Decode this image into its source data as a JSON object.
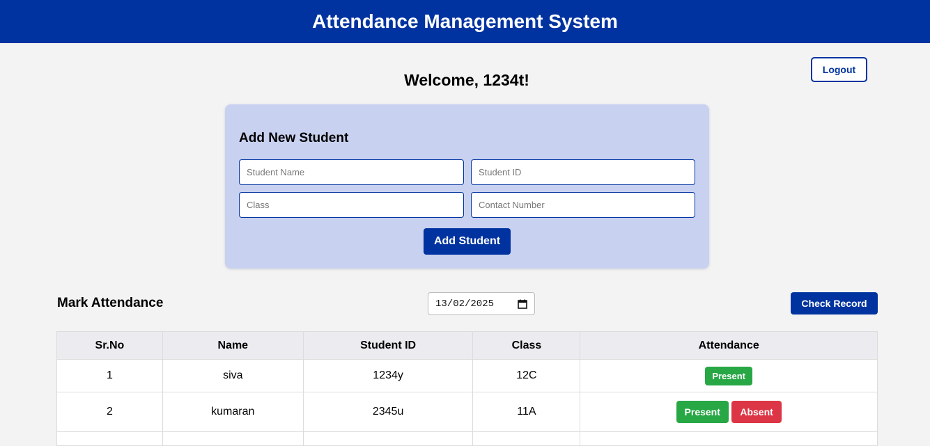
{
  "header": {
    "title": "Attendance Management System"
  },
  "logout_label": "Logout",
  "welcome": "Welcome, 1234t!",
  "add_student": {
    "title": "Add New Student",
    "name_placeholder": "Student Name",
    "id_placeholder": "Student ID",
    "class_placeholder": "Class",
    "contact_placeholder": "Contact Number",
    "button_label": "Add Student"
  },
  "attendance": {
    "title": "Mark Attendance",
    "date": "13/02/2025",
    "check_label": "Check Record",
    "columns": [
      "Sr.No",
      "Name",
      "Student ID",
      "Class",
      "Attendance"
    ],
    "rows": [
      {
        "sr": "1",
        "name": "siva",
        "id": "1234y",
        "class": "12C",
        "present": "Present"
      },
      {
        "sr": "2",
        "name": "kumaran",
        "id": "2345u",
        "class": "11A",
        "present": "Present",
        "absent": "Absent"
      }
    ]
  },
  "colors": {
    "primary": "#0033a0",
    "present": "#28a745",
    "absent": "#dc3545",
    "card": "#c8d1f0"
  }
}
